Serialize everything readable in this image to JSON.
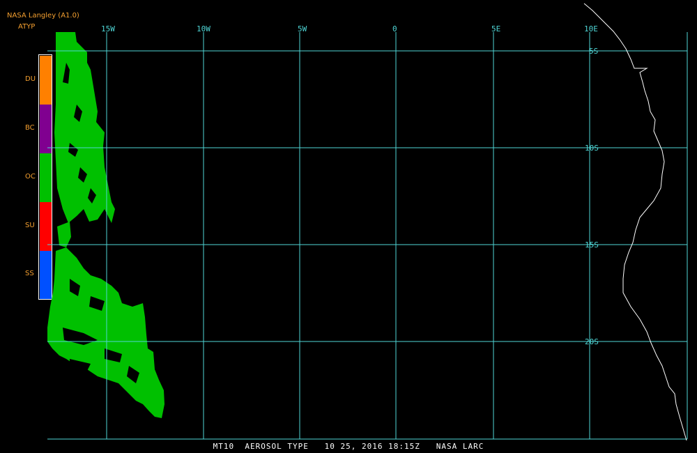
{
  "header": {
    "agency": "NASA Langley (A1.0)",
    "product_code": "ATYP"
  },
  "legend": {
    "items": [
      {
        "code": "DU",
        "color": "#ff8000"
      },
      {
        "code": "BC",
        "color": "#800090"
      },
      {
        "code": "OC",
        "color": "#00c000"
      },
      {
        "code": "SU",
        "color": "#ff0000"
      },
      {
        "code": "SS",
        "color": "#0050ff"
      }
    ]
  },
  "grid": {
    "longitudes": [
      "15W",
      "10W",
      "5W",
      "0",
      "5E",
      "10E"
    ],
    "latitudes": [
      "5S",
      "10S",
      "15S",
      "20S"
    ],
    "grid_color": "#4fd6d6",
    "coastline_color": "#ffffff"
  },
  "footer": {
    "text": "MT10  AEROSOL TYPE   10 25, 2016 18:15Z   NASA LARC"
  },
  "map": {
    "aerosol_type_shown": "OC",
    "swath_color": "#00c000"
  }
}
